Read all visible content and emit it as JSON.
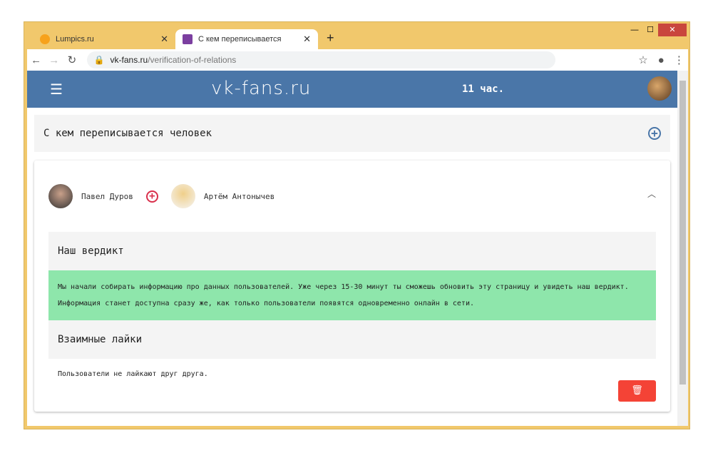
{
  "browser": {
    "tabs": [
      {
        "title": "Lumpics.ru"
      },
      {
        "title": "С кем переписывается"
      }
    ],
    "url_domain": "vk-fans.ru",
    "url_path": "/verification-of-relations"
  },
  "header": {
    "logo": "vk-fans.ru",
    "time": "11 час."
  },
  "section": {
    "title": "С кем переписывается человек"
  },
  "users": [
    {
      "name": "Павел Дуров"
    },
    {
      "name": "Артём Антонычев"
    }
  ],
  "verdict": {
    "title": "Наш вердикт",
    "lines": [
      "Мы начали собирать информацию про данных пользователей. Уже через 15-30 минут ты сможешь обновить эту страницу и увидеть наш вердикт.",
      "Информация станет доступна сразу же, как только пользователи появятся одновременно онлайн в сети."
    ]
  },
  "likes": {
    "title": "Взаимные лайки",
    "text": "Пользователи не лайкают друг друга."
  },
  "colors": {
    "header": "#4a76a8",
    "verdict_bg": "#8ee6ab",
    "delete": "#f44336"
  }
}
